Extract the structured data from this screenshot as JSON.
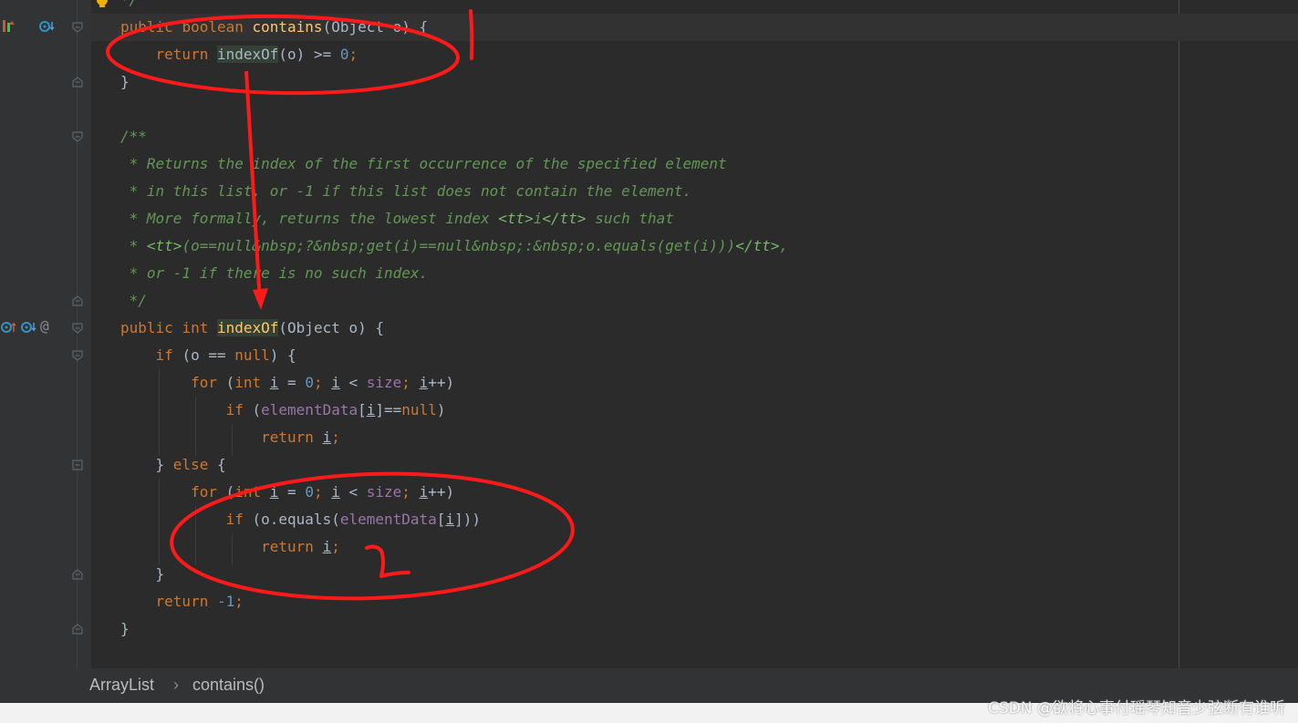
{
  "editor": {
    "lines": [
      {
        "tokens": [
          [
            "*/",
            "doc"
          ]
        ]
      },
      {
        "tokens": [
          [
            "public ",
            "kw"
          ],
          [
            "boolean ",
            "kw"
          ],
          [
            "contains",
            "fn"
          ],
          [
            "(Object o) {",
            ""
          ]
        ]
      },
      {
        "tokens": [
          [
            "    ",
            ""
          ],
          [
            "return ",
            "kw"
          ],
          [
            "indexOf",
            "hlw"
          ],
          [
            "(o) >= ",
            ""
          ],
          [
            "0",
            "num"
          ],
          [
            ";",
            "kw"
          ]
        ]
      },
      {
        "tokens": [
          [
            "}",
            ""
          ]
        ]
      },
      {
        "tokens": []
      },
      {
        "tokens": [
          [
            "/**",
            "doc"
          ]
        ]
      },
      {
        "tokens": [
          [
            " * Returns the index of the first occurrence of the specified element",
            "doc"
          ]
        ]
      },
      {
        "tokens": [
          [
            " * in this list, or -1 if this list does not contain the element.",
            "doc"
          ]
        ]
      },
      {
        "tokens": [
          [
            " * More formally, returns the lowest index ",
            "doc"
          ],
          [
            "<tt>",
            "tag"
          ],
          [
            "i",
            "doc"
          ],
          [
            "</tt>",
            "tag"
          ],
          [
            " such that",
            "doc"
          ]
        ]
      },
      {
        "tokens": [
          [
            " * ",
            "doc"
          ],
          [
            "<tt>",
            "tag"
          ],
          [
            "(o==null&nbsp;?&nbsp;get(i)==null&nbsp;:&nbsp;o.equals(get(i)))",
            "doc"
          ],
          [
            "</tt>",
            "tag"
          ],
          [
            ",",
            "doc"
          ]
        ]
      },
      {
        "tokens": [
          [
            " * or -1 if there is no such index.",
            "doc"
          ]
        ]
      },
      {
        "tokens": [
          [
            " */",
            "doc"
          ]
        ]
      },
      {
        "tokens": [
          [
            "public ",
            "kw"
          ],
          [
            "int ",
            "kw"
          ],
          [
            "indexOf",
            "fnhl"
          ],
          [
            "(Object o) {",
            ""
          ]
        ]
      },
      {
        "tokens": [
          [
            "    ",
            ""
          ],
          [
            "if ",
            "kw"
          ],
          [
            "(o == ",
            ""
          ],
          [
            "null",
            "kw"
          ],
          [
            ") {",
            ""
          ]
        ]
      },
      {
        "tokens": [
          [
            "        ",
            ""
          ],
          [
            "for ",
            "kw"
          ],
          [
            "(",
            ""
          ],
          [
            "int ",
            "kw"
          ],
          [
            "i",
            "ul"
          ],
          [
            " = ",
            ""
          ],
          [
            "0",
            "num"
          ],
          [
            "; ",
            "kw"
          ],
          [
            "i",
            "ul"
          ],
          [
            " < ",
            ""
          ],
          [
            "size",
            "fld"
          ],
          [
            "; ",
            "kw"
          ],
          [
            "i",
            "ul"
          ],
          [
            "++)",
            ""
          ]
        ]
      },
      {
        "tokens": [
          [
            "            ",
            ""
          ],
          [
            "if ",
            "kw"
          ],
          [
            "(",
            ""
          ],
          [
            "elementData",
            "fld"
          ],
          [
            "[",
            ""
          ],
          [
            "i",
            "ul"
          ],
          [
            "]==",
            ""
          ],
          [
            "null",
            "kw"
          ],
          [
            ")",
            ""
          ]
        ]
      },
      {
        "tokens": [
          [
            "                ",
            ""
          ],
          [
            "return ",
            "kw"
          ],
          [
            "i",
            "ul"
          ],
          [
            ";",
            "kw"
          ]
        ]
      },
      {
        "tokens": [
          [
            "    } ",
            ""
          ],
          [
            "else ",
            "kw"
          ],
          [
            "{",
            ""
          ]
        ]
      },
      {
        "tokens": [
          [
            "        ",
            ""
          ],
          [
            "for ",
            "kw"
          ],
          [
            "(",
            ""
          ],
          [
            "int ",
            "kw"
          ],
          [
            "i",
            "ul"
          ],
          [
            " = ",
            ""
          ],
          [
            "0",
            "num"
          ],
          [
            "; ",
            "kw"
          ],
          [
            "i",
            "ul"
          ],
          [
            " < ",
            ""
          ],
          [
            "size",
            "fld"
          ],
          [
            "; ",
            "kw"
          ],
          [
            "i",
            "ul"
          ],
          [
            "++)",
            ""
          ]
        ]
      },
      {
        "tokens": [
          [
            "            ",
            ""
          ],
          [
            "if ",
            "kw"
          ],
          [
            "(o.equals(",
            ""
          ],
          [
            "elementData",
            "fld"
          ],
          [
            "[",
            ""
          ],
          [
            "i",
            "ul"
          ],
          [
            "]))",
            ""
          ]
        ]
      },
      {
        "tokens": [
          [
            "                ",
            ""
          ],
          [
            "return ",
            "kw"
          ],
          [
            "i",
            "ul"
          ],
          [
            ";",
            "kw"
          ]
        ]
      },
      {
        "tokens": [
          [
            "    }",
            ""
          ]
        ]
      },
      {
        "tokens": [
          [
            "    ",
            ""
          ],
          [
            "return ",
            "kw"
          ],
          [
            "-",
            "num"
          ],
          [
            "1",
            "num"
          ],
          [
            ";",
            "kw"
          ]
        ]
      },
      {
        "tokens": [
          [
            "}",
            ""
          ]
        ]
      }
    ]
  },
  "breadcrumb": {
    "class_name": "ArrayList",
    "separator": "›",
    "method_name": "contains()"
  },
  "watermark": "CSDN @欲将心事付瑶琴知音少弦断有谁听",
  "colors": {
    "annotation": "#ff1a1a",
    "background": "#2b2b2b",
    "keyword": "#cc7832"
  },
  "icons": {
    "implements_method": "implements-method-icon",
    "overrides_method": "overrides-method-icon",
    "bulb": "intention-bulb-icon",
    "at": "annotation-at-icon"
  }
}
